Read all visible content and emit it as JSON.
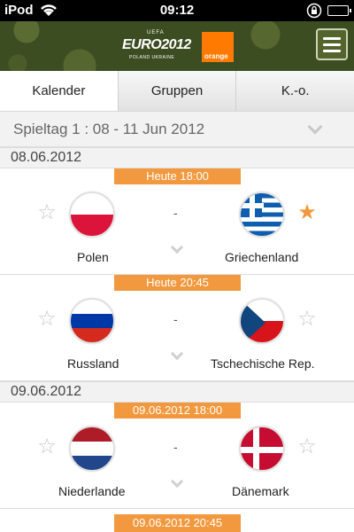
{
  "status_bar": {
    "carrier": "iPod",
    "time": "09:12"
  },
  "header": {
    "logo_uefa": "UEFA",
    "logo_text": "EURO2012",
    "logo_sub": "POLAND UKRAINE",
    "sponsor": "orange"
  },
  "tabs": [
    {
      "label": "Kalender",
      "active": true
    },
    {
      "label": "Gruppen",
      "active": false
    },
    {
      "label": "K.-o.",
      "active": false
    }
  ],
  "matchday": "Spieltag 1 : 08 - 11 Jun 2012",
  "days": [
    {
      "date": "08.06.2012",
      "matches": [
        {
          "kickoff": "Heute 18:00",
          "home": "Polen",
          "away": "Griechenland",
          "separator": "-",
          "home_fav": false,
          "away_fav": true
        },
        {
          "kickoff": "Heute 20:45",
          "home": "Russland",
          "away": "Tschechische Rep.",
          "separator": "-",
          "home_fav": false,
          "away_fav": false
        }
      ]
    },
    {
      "date": "09.06.2012",
      "matches": [
        {
          "kickoff": "09.06.2012 18:00",
          "home": "Niederlande",
          "away": "Dänemark",
          "separator": "-",
          "home_fav": false,
          "away_fav": false
        },
        {
          "kickoff": "09.06.2012 20:45"
        }
      ]
    }
  ],
  "colors": {
    "accent": "#f2993f",
    "header_bg": "#3d4d22"
  }
}
